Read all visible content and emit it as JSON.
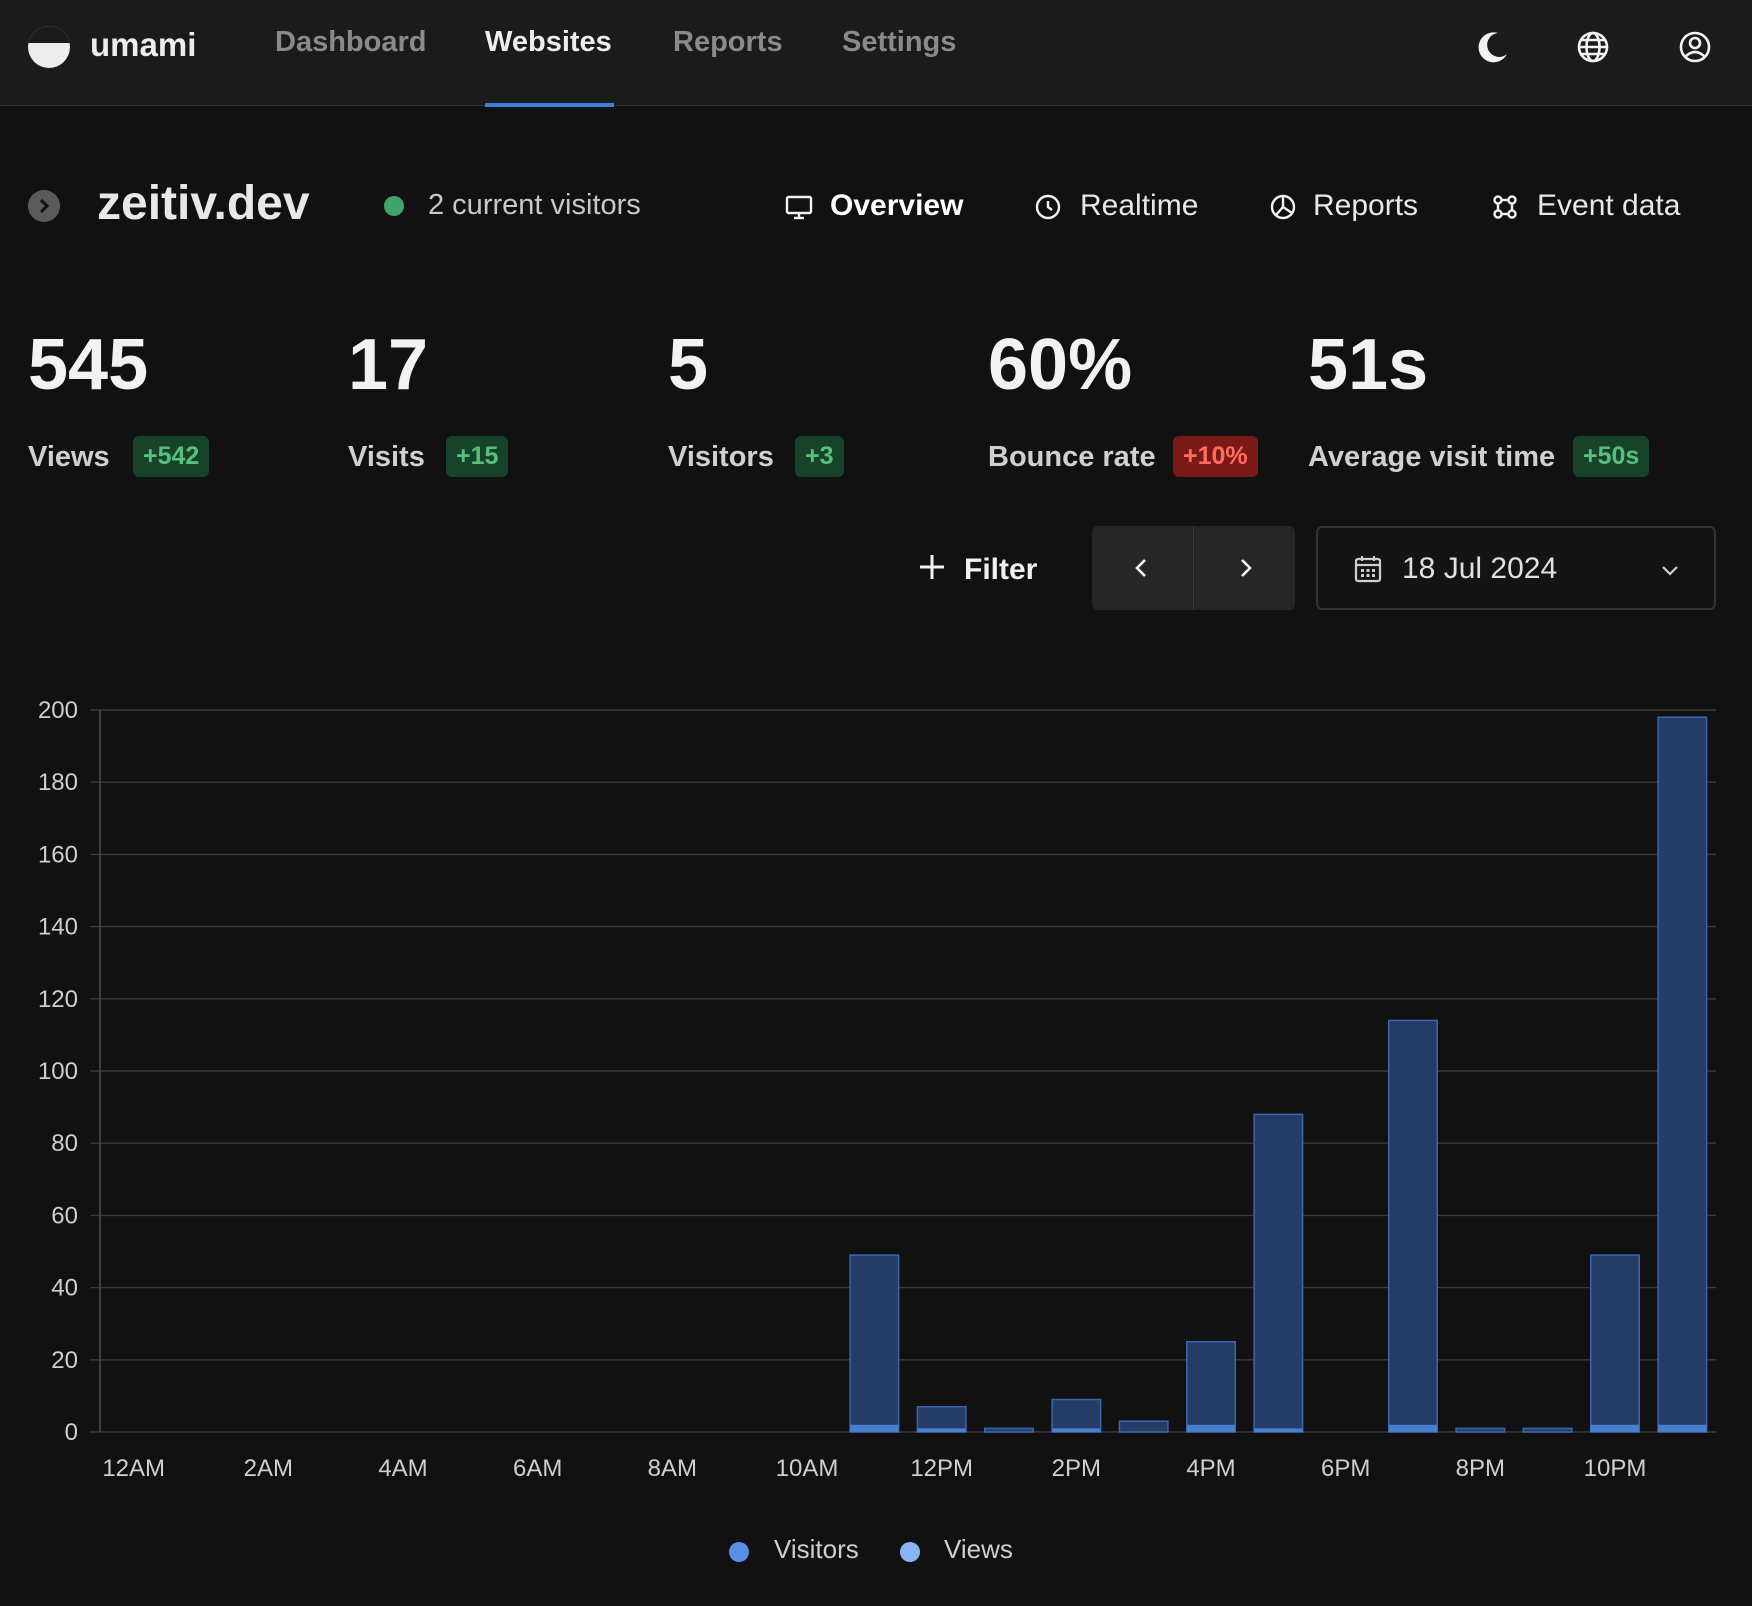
{
  "app": {
    "brand": "umami",
    "nav": [
      {
        "label": "Dashboard",
        "active": false
      },
      {
        "label": "Websites",
        "active": true
      },
      {
        "label": "Reports",
        "active": false
      },
      {
        "label": "Settings",
        "active": false
      }
    ],
    "icons": [
      "moon-icon",
      "globe-icon",
      "user-profile-icon"
    ]
  },
  "website": {
    "name": "zeitiv.dev",
    "current_visitors": "2 current visitors",
    "tabs": [
      {
        "label": "Overview",
        "icon": "monitor-icon",
        "active": true
      },
      {
        "label": "Realtime",
        "icon": "clock-icon",
        "active": false
      },
      {
        "label": "Reports",
        "icon": "pie-chart-icon",
        "active": false
      },
      {
        "label": "Event data",
        "icon": "nodes-icon",
        "active": false
      }
    ]
  },
  "metrics": [
    {
      "value": "545",
      "label": "Views",
      "change": "+542",
      "trend": "up"
    },
    {
      "value": "17",
      "label": "Visits",
      "change": "+15",
      "trend": "up"
    },
    {
      "value": "5",
      "label": "Visitors",
      "change": "+3",
      "trend": "up"
    },
    {
      "value": "60%",
      "label": "Bounce rate",
      "change": "+10%",
      "trend": "down"
    },
    {
      "value": "51s",
      "label": "Average visit time",
      "change": "+50s",
      "trend": "up"
    }
  ],
  "controls": {
    "filter_label": "Filter",
    "date_label": "18 Jul 2024"
  },
  "colors": {
    "accent": "#3f7fe0",
    "bar_fill": "#243c66",
    "bar_stroke": "#3a66b0",
    "visitors_bar": "#4a7fd0",
    "positive_badge": "#17432a",
    "negative_badge": "#7a1a17",
    "live_dot": "#3fa46a"
  },
  "chart_data": {
    "type": "bar",
    "x": [
      "12AM",
      "1AM",
      "2AM",
      "3AM",
      "4AM",
      "5AM",
      "6AM",
      "7AM",
      "8AM",
      "9AM",
      "10AM",
      "11AM",
      "12PM",
      "1PM",
      "2PM",
      "3PM",
      "4PM",
      "5PM",
      "6PM",
      "7PM",
      "8PM",
      "9PM",
      "10PM",
      "11PM"
    ],
    "x_tick_labels": [
      "12AM",
      "2AM",
      "4AM",
      "6AM",
      "8AM",
      "10AM",
      "12PM",
      "2PM",
      "4PM",
      "6PM",
      "8PM",
      "10PM"
    ],
    "series": [
      {
        "name": "Visitors",
        "color": "#5b8ee6",
        "values": [
          0,
          0,
          0,
          0,
          0,
          0,
          0,
          0,
          0,
          0,
          0,
          2,
          1,
          0,
          1,
          0,
          2,
          1,
          0,
          2,
          0,
          0,
          2,
          2
        ]
      },
      {
        "name": "Views",
        "color": "#8ab4f5",
        "values": [
          0,
          0,
          0,
          0,
          0,
          0,
          0,
          0,
          0,
          0,
          0,
          49,
          7,
          1,
          9,
          3,
          25,
          88,
          0,
          114,
          1,
          1,
          49,
          198
        ]
      }
    ],
    "ylim": [
      0,
      200
    ],
    "y_ticks": [
      0,
      20,
      40,
      60,
      80,
      100,
      120,
      140,
      160,
      180,
      200
    ],
    "grid": true,
    "legend": "bottom-center"
  }
}
